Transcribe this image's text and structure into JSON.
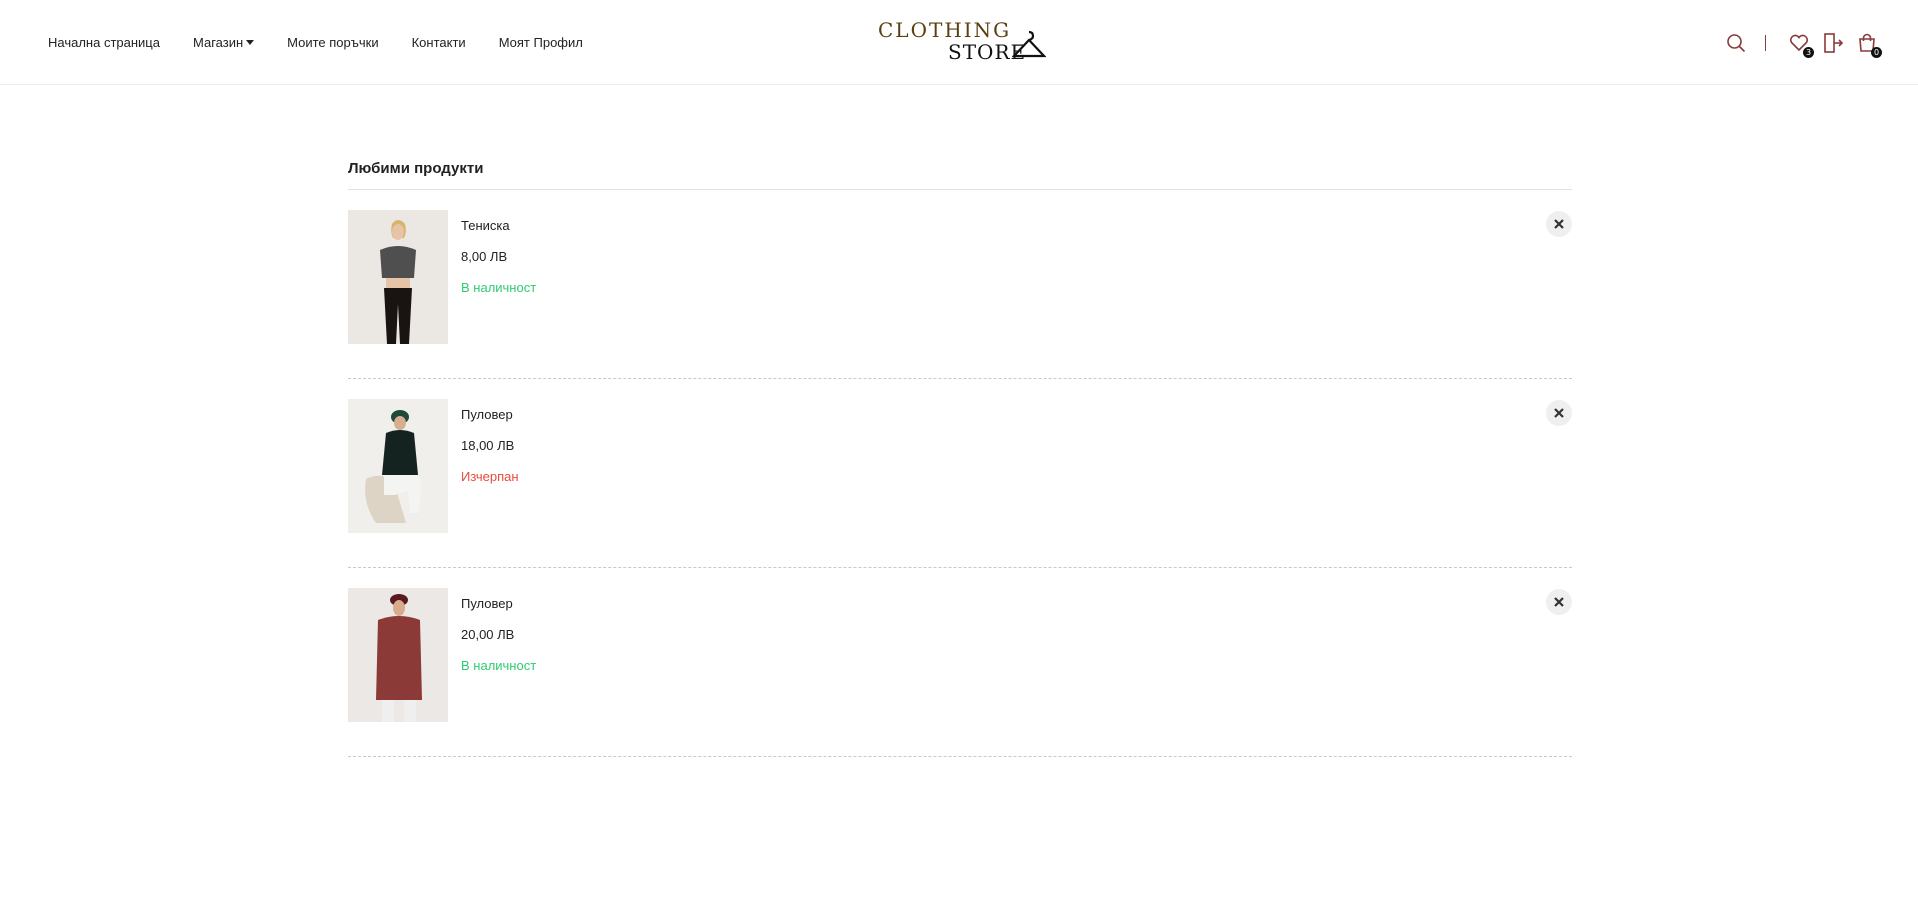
{
  "nav": {
    "home": "Начална страница",
    "shop": "Магазин",
    "orders": "Моите поръчки",
    "contacts": "Контакти",
    "profile": "Моят  Профил"
  },
  "logo": {
    "top": "CLOTHING",
    "bottom": "STORE"
  },
  "header_icons": {
    "search": "search-icon",
    "wishlist": "heart-icon",
    "wishlist_count": "3",
    "logout": "logout-icon",
    "cart": "shopping-bag-icon",
    "cart_count": "0"
  },
  "favorites": {
    "title": "Любими продукти",
    "items": [
      {
        "name": "Тениска",
        "price": "8,00 ЛВ",
        "stock": "В наличност",
        "stock_color": "#2ecc71"
      },
      {
        "name": "Пуловер",
        "price": "18,00 ЛВ",
        "stock": "Изчерпан",
        "stock_color": "#e74c3c"
      },
      {
        "name": "Пуловер",
        "price": "20,00 ЛВ",
        "stock": "В наличност",
        "stock_color": "#2ecc71"
      }
    ]
  },
  "colors": {
    "accent": "#8a3a3a",
    "in_stock": "#2ecc71",
    "out_of_stock": "#e74c3c"
  }
}
